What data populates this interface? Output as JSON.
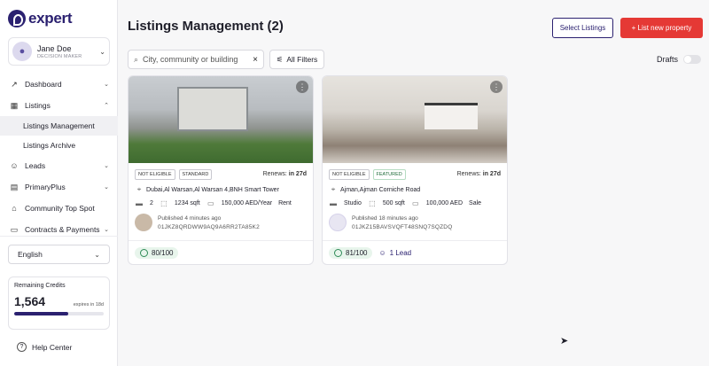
{
  "brand": {
    "logo_text": "expert"
  },
  "user": {
    "name": "Jane Doe",
    "role": "DECISION MAKER"
  },
  "nav": {
    "dashboard": "Dashboard",
    "listings": "Listings",
    "listings_management": "Listings Management",
    "listings_archive": "Listings Archive",
    "leads": "Leads",
    "primary_plus": "PrimaryPlus",
    "community_top_spot": "Community Top Spot",
    "contracts_payments": "Contracts & Payments"
  },
  "language": {
    "selected": "English"
  },
  "credits": {
    "title": "Remaining Credits",
    "value": "1,564",
    "expires": "expires in 18d",
    "progress": 0.6
  },
  "help": "Help Center",
  "page": {
    "title": "Listings Management (2)"
  },
  "toolbar": {
    "select_listings": "Select Listings",
    "list_new_property": "+ List new property",
    "search_placeholder": "City, community or building",
    "all_filters": "All Filters",
    "drafts": "Drafts"
  },
  "listings": [
    {
      "eligibility": "NOT ELIGIBLE",
      "tier": "STANDARD",
      "renews_label": "Renews:",
      "renews_value": "in 27d",
      "location": "Dubai,Al Warsan,Al Warsan 4,BNH Smart Tower",
      "beds": "2",
      "size": "1234 sqft",
      "price": "150,000 AED/Year",
      "purpose": "Rent",
      "published": "Published 4 minutes ago",
      "id": "01JKZ8QRDWW9AQ9A6RR2TA85K2",
      "score": "80/100"
    },
    {
      "eligibility": "NOT ELIGIBLE",
      "tier": "FEATURED",
      "renews_label": "Renews:",
      "renews_value": "in 27d",
      "location": "Ajman,Ajman Corniche Road",
      "beds": "Studio",
      "size": "500 sqft",
      "price": "100,000 AED",
      "purpose": "Sale",
      "published": "Published 18 minutes ago",
      "id": "01JKZ15BAVSVQFT48SNQ7SQZDQ",
      "score": "81/100",
      "leads": "1 Lead"
    }
  ]
}
